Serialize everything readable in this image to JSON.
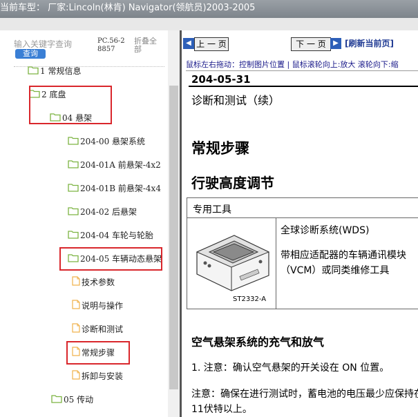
{
  "title": {
    "text": "当前车型： 厂家:Lincoln(林肯) Navigator(领航员)2003-2005"
  },
  "sidebar": {
    "search_placeholder": "输入关键字查询",
    "search_button": "查询",
    "code": "PC.56-28857",
    "collapse_all": "折叠全部",
    "tree": [
      {
        "label": "1 常规信息",
        "type": "folder"
      },
      {
        "label": "2 底盘",
        "type": "folder"
      },
      {
        "label": "04 悬架",
        "type": "folder"
      },
      {
        "label": "204-00 悬架系统",
        "type": "folder"
      },
      {
        "label": "204-01A 前悬架-4x2",
        "type": "folder"
      },
      {
        "label": "204-01B 前悬架-4x4",
        "type": "folder"
      },
      {
        "label": "204-02 后悬架",
        "type": "folder"
      },
      {
        "label": "204-04 车轮与轮胎",
        "type": "folder"
      },
      {
        "label": "204-05 车辆动态悬架",
        "type": "folder"
      },
      {
        "label": "技术参数",
        "type": "doc"
      },
      {
        "label": "说明与操作",
        "type": "doc"
      },
      {
        "label": "诊断和测试",
        "type": "doc"
      },
      {
        "label": "常规步骤",
        "type": "doc"
      },
      {
        "label": "拆卸与安装",
        "type": "doc"
      },
      {
        "label": "05 传动",
        "type": "folder"
      }
    ]
  },
  "toolbar": {
    "prev_label": "上 一 页",
    "next_label": "下 一 页",
    "refresh_label": "[刷新当前页]",
    "hint": "鼠标左右拖动：控制图片位置 | 鼠标滚轮向上:放大   滚轮向下:缩"
  },
  "doc": {
    "number": "204-05-31",
    "subtitle": "诊断和测试（续）",
    "heading": "常规步骤",
    "section": "行驶高度调节",
    "special_tools_header": "专用工具",
    "tool_caption": "ST2332-A",
    "tool_name": "全球诊断系统(WDS)",
    "tool_desc": "带相应适配器的车辆通讯模块（VCM）或同类维修工具",
    "subsection": "空气悬架系统的充气和放气",
    "step1": "1.    注意：确认空气悬架的开关设在 ON 位置。",
    "note": "注意：确保在进行测试时，蓄电池的电压最少应保持在11伏特以上。"
  },
  "colors": {
    "highlight": "#d9262b",
    "folder": "#7cb342",
    "doc_icon": "#f0b24c",
    "nav_icon": "#2d5fb8"
  }
}
